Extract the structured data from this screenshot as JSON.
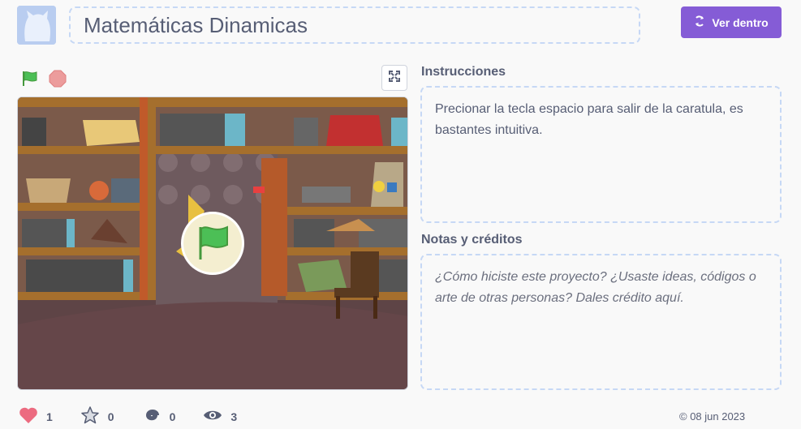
{
  "header": {
    "title": "Matemáticas Dinamicas",
    "see_inside_label": "Ver dentro"
  },
  "instructions": {
    "label": "Instrucciones",
    "text": "Precionar la tecla espacio  para salir de la caratula, es bastantes intuitiva."
  },
  "notes": {
    "label": "Notas y créditos",
    "placeholder": "¿Cómo hiciste este proyecto? ¿Usaste ideas, códigos o arte de otras personas? Dales crédito aquí."
  },
  "stats": {
    "loves": "1",
    "favorites": "0",
    "remixes": "0",
    "views": "3"
  },
  "date": "© 08 jun 2023",
  "colors": {
    "accent": "#855cd6",
    "text": "#575e75",
    "flag": "#4cbf56",
    "stop": "#ec9c9c",
    "love": "#ec6b80"
  },
  "icons": [
    "green-flag-icon",
    "stop-icon",
    "fullscreen-icon",
    "remix-icon",
    "heart-icon",
    "star-icon",
    "spiral-icon",
    "eye-icon"
  ]
}
